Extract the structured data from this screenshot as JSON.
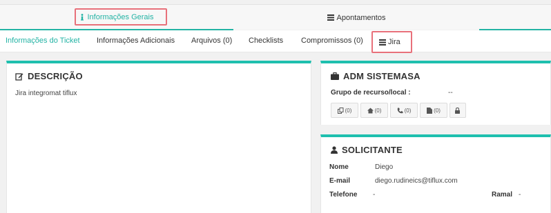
{
  "top_tabs": [
    {
      "label": "Informações Gerais",
      "icon": "info-icon"
    },
    {
      "label": "Apontamentos",
      "icon": "list-icon"
    }
  ],
  "sub_tabs": [
    {
      "label": "Informações do Ticket"
    },
    {
      "label": "Informações Adicionais"
    },
    {
      "label": "Arquivos (0)"
    },
    {
      "label": "Checklists"
    },
    {
      "label": "Compromissos (0)"
    },
    {
      "label": "Jira",
      "icon": "list-icon"
    }
  ],
  "descricao": {
    "title": "DESCRIÇÃO",
    "text": "Jira integromat tiflux"
  },
  "empresa": {
    "title": "ADM SISTEMASA",
    "group_label": "Grupo de recurso/local :",
    "group_value": "--",
    "buttons": [
      {
        "icon": "copy-icon",
        "count": "(0)"
      },
      {
        "icon": "home-icon",
        "count": "(0)"
      },
      {
        "icon": "phone-icon",
        "count": "(0)"
      },
      {
        "icon": "file-icon",
        "count": "(0)"
      },
      {
        "icon": "lock-icon",
        "count": ""
      }
    ]
  },
  "solicitante": {
    "title": "SOLICITANTE",
    "nome_label": "Nome",
    "nome_value": "Diego",
    "email_label": "E-mail",
    "email_value": "diego.rudineics@tiflux.com",
    "telefone_label": "Telefone",
    "telefone_value": "-",
    "ramal_label": "Ramal",
    "ramal_value": "-"
  },
  "colors": {
    "accent": "#22b3a4",
    "panel_border": "#1ebfae",
    "highlight": "#e8707a"
  }
}
